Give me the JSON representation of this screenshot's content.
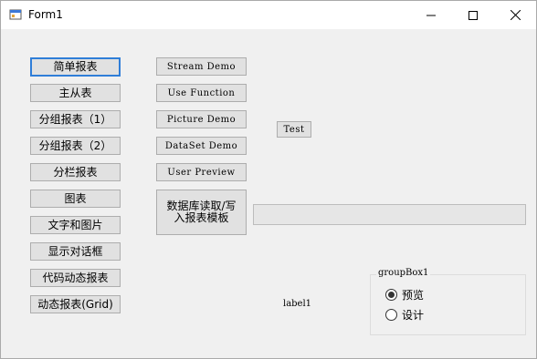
{
  "window": {
    "title": "Form1"
  },
  "left_buttons": [
    "简单报表",
    "主从表",
    "分组报表（1）",
    "分组报表（2）",
    "分栏报表",
    "图表",
    "文字和图片",
    "显示对话框",
    "代码动态报表",
    "动态报表(Grid)"
  ],
  "middle_buttons": [
    "Stream Demo",
    "Use Function",
    "Picture Demo",
    "DataSet Demo",
    "User Preview",
    "数据库读取/写入报表模板"
  ],
  "test_button": "Test",
  "progress_value": 0,
  "label1": "label1",
  "groupbox": {
    "title": "groupBox1",
    "options": [
      {
        "label": "预览",
        "checked": true
      },
      {
        "label": "设计",
        "checked": false
      }
    ]
  }
}
